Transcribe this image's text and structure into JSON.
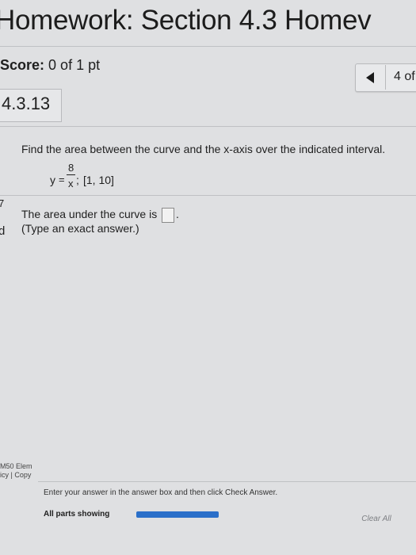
{
  "header": {
    "title": "Homework: Section 4.3 Homev",
    "score_label": "Score:",
    "score_value": "0 of 1 pt",
    "question_count": "4 of"
  },
  "question": {
    "number": "4.3.13",
    "prompt": "Find the area between the curve and the x-axis over the indicated interval.",
    "equation": {
      "lhs": "y",
      "equals": "=",
      "numerator": "8",
      "denominator": "x",
      "separator": ";",
      "interval": "[1, 10]"
    },
    "answer_label": "The area under the curve is",
    "answer_value": "",
    "answer_suffix": ".",
    "hint": "(Type an exact answer.)"
  },
  "left_edge": {
    "top_fragment": "7",
    "mid_fragment": "d",
    "footer_line1": "M50 Elem",
    "footer_line2": "icy | Copy"
  },
  "footer": {
    "instruction": "Enter your answer in the answer box and then click Check Answer.",
    "status": "All parts showing",
    "progress_percent": 100,
    "clear_all_label": "Clear All"
  },
  "colors": {
    "progress_fill": "#2a6fc9",
    "background": "#dfe0e2"
  }
}
